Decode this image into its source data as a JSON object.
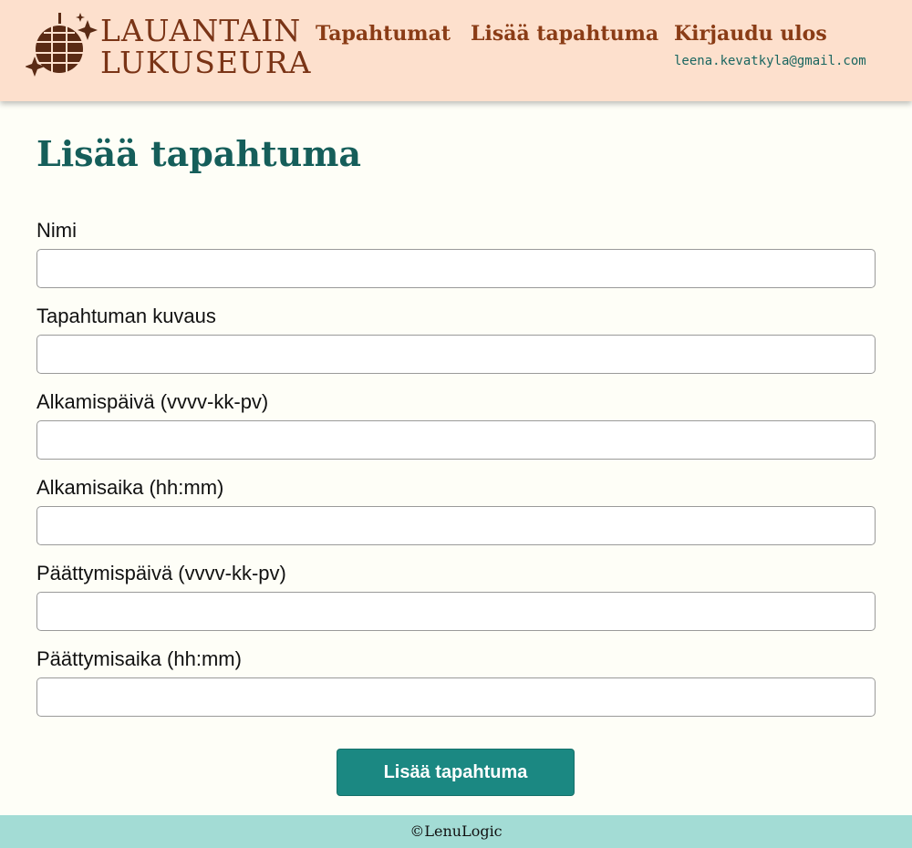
{
  "header": {
    "logo_line1": "LAUANTAIN",
    "logo_line2": "LUKUSEURA",
    "nav": {
      "events": "Tapahtumat",
      "add_event": "Lisää tapahtuma",
      "logout": "Kirjaudu ulos",
      "user_email": "leena.kevatkyla@gmail.com"
    }
  },
  "main": {
    "title": "Lisää tapahtuma",
    "fields": [
      {
        "label": "Nimi",
        "value": "",
        "placeholder": ""
      },
      {
        "label": "Tapahtuman kuvaus",
        "value": "",
        "placeholder": ""
      },
      {
        "label": "Alkamispäivä (vvvv-kk-pv)",
        "value": "",
        "placeholder": ""
      },
      {
        "label": "Alkamisaika (hh:mm)",
        "value": "",
        "placeholder": ""
      },
      {
        "label": "Päättymispäivä (vvvv-kk-pv)",
        "value": "",
        "placeholder": ""
      },
      {
        "label": "Päättymisaika (hh:mm)",
        "value": "",
        "placeholder": ""
      }
    ],
    "submit_label": "Lisää tapahtuma"
  },
  "footer": {
    "text": "©LenuLogic"
  },
  "colors": {
    "header_bg": "#fde0cd",
    "brand_brown": "#7a3416",
    "title_teal": "#155e5a",
    "button_teal": "#1b8882",
    "footer_bg": "#a3dcd5",
    "page_bg": "#fefef7"
  },
  "icons": {
    "logo": "disco-ball-sparkles-icon"
  }
}
